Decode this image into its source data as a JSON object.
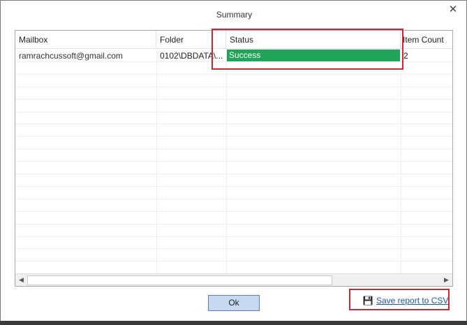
{
  "dialog": {
    "title": "Summary",
    "close_glyph": "✕"
  },
  "grid": {
    "columns": [
      "Mailbox",
      "Folder",
      "Status",
      "Item Count"
    ],
    "rows": [
      {
        "mailbox": "ramrachcussoft@gmail.com",
        "folder": "0102\\DBDATA\\...",
        "status": "Success",
        "item_count": "2"
      }
    ],
    "status_color": "#21a35a"
  },
  "scrollbar": {
    "left_arrow": "◀",
    "right_arrow": "▶"
  },
  "buttons": {
    "ok_label": "Ok"
  },
  "report": {
    "save_label": "Save report to CSV",
    "icon": "floppy-disk-icon"
  },
  "colors": {
    "highlight": "#c8283a",
    "link": "#1a56b8",
    "ok_bg": "#c6d9f0"
  }
}
